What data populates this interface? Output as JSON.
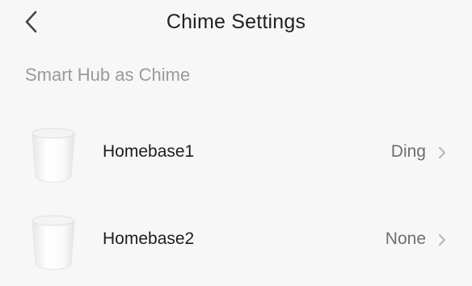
{
  "header": {
    "title": "Chime Settings",
    "back_icon": "chevron-left-icon"
  },
  "section": {
    "label": "Smart Hub as Chime"
  },
  "devices": [
    {
      "name": "Homebase1",
      "value": "Ding",
      "icon": "homebase-device-icon"
    },
    {
      "name": "Homebase2",
      "value": "None",
      "icon": "homebase-device-icon"
    }
  ],
  "colors": {
    "background": "#f7f7f7",
    "title": "#222222",
    "section_label": "#9a9a9a",
    "value_text": "#6f6f6f",
    "chevron": "#b8b8b8"
  }
}
